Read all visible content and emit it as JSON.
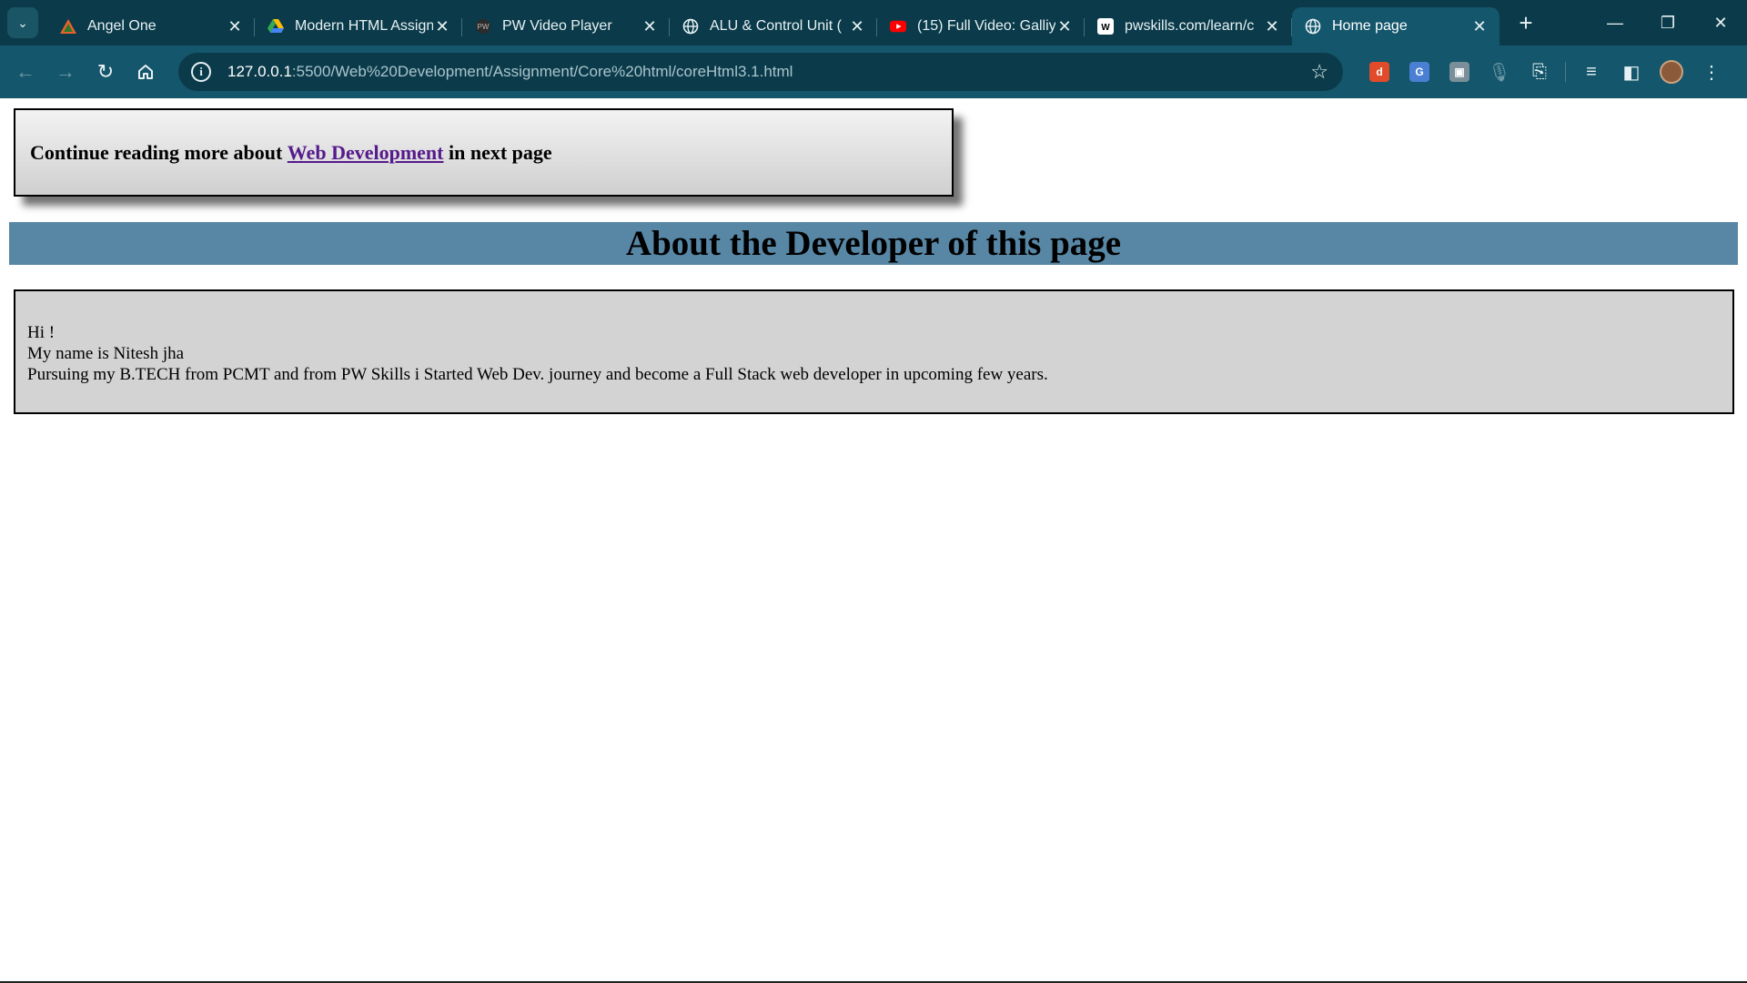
{
  "browser": {
    "tabs": [
      {
        "title": "Angel One",
        "icon": "angel-one-icon",
        "active": false
      },
      {
        "title": "Modern HTML Assign",
        "icon": "google-drive-icon",
        "active": false
      },
      {
        "title": "PW Video Player",
        "icon": "pw-icon",
        "active": false
      },
      {
        "title": "ALU & Control Unit (",
        "icon": "globe-icon",
        "active": false
      },
      {
        "title": "(15) Full Video: Galliy",
        "icon": "youtube-icon",
        "active": false
      },
      {
        "title": "pwskills.com/learn/c",
        "icon": "pwskills-icon",
        "active": false
      },
      {
        "title": "Home page",
        "icon": "globe-icon",
        "active": true
      }
    ],
    "url_host": "127.0.0.1",
    "url_rest": ":5500/Web%20Development/Assignment/Core%20html/coreHtml3.1.html"
  },
  "page": {
    "callout": {
      "prefix": "Continue reading more about ",
      "link_text": "Web Development",
      "suffix": " in next page"
    },
    "heading": "About the Developer of this page",
    "about_lines": [
      "Hi !",
      "My name is Nitesh jha",
      "Pursuing my B.TECH from PCMT and from PW Skills i Started Web Dev. journey and become a Full Stack web developer in upcoming few years."
    ]
  }
}
